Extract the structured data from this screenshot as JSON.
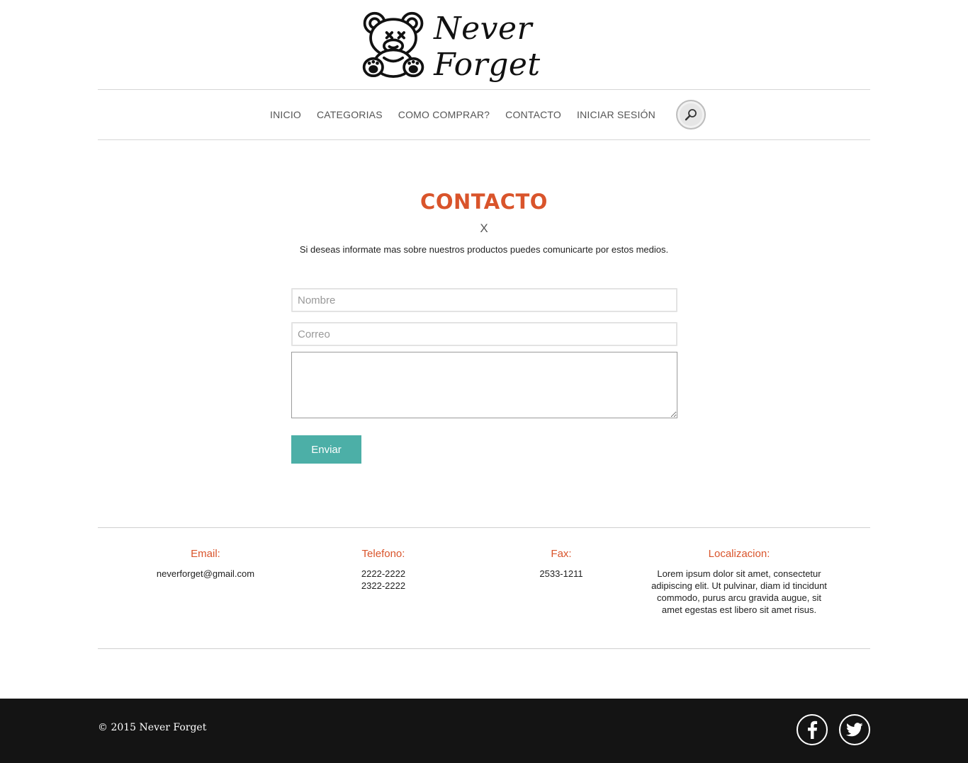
{
  "header": {
    "logo_text": "Never Forget"
  },
  "nav": {
    "items": [
      "INICIO",
      "CATEGORIAS",
      "COMO COMPRAR?",
      "CONTACTO",
      "INICIAR SESIÓN"
    ]
  },
  "contact": {
    "title": "CONTACTO",
    "close": "X",
    "intro": "Si deseas informate mas sobre nuestros productos puedes comunicarte por estos medios.",
    "name_placeholder": "Nombre",
    "email_placeholder": "Correo",
    "message_value": "",
    "send_label": "Enviar"
  },
  "info": {
    "email_heading": "Email:",
    "email_value": "neverforget@gmail.com",
    "phone_heading": "Telefono:",
    "phone_1": "2222-2222",
    "phone_2": "2322-2222",
    "fax_heading": "Fax:",
    "fax_value": "2533-1211",
    "location_heading": "Localizacion:",
    "location_value": "Lorem ipsum dolor sit amet, consectetur adipiscing elit. Ut pulvinar, diam id tincidunt commodo, purus arcu gravida augue, sit amet egestas est libero sit amet risus."
  },
  "footer": {
    "copyright": "© 2015 Never Forget",
    "social": [
      "facebook-icon",
      "twitter-icon"
    ]
  },
  "colors": {
    "accent": "#d9542b",
    "button": "#4cafa7",
    "footer_bg": "#141414"
  }
}
